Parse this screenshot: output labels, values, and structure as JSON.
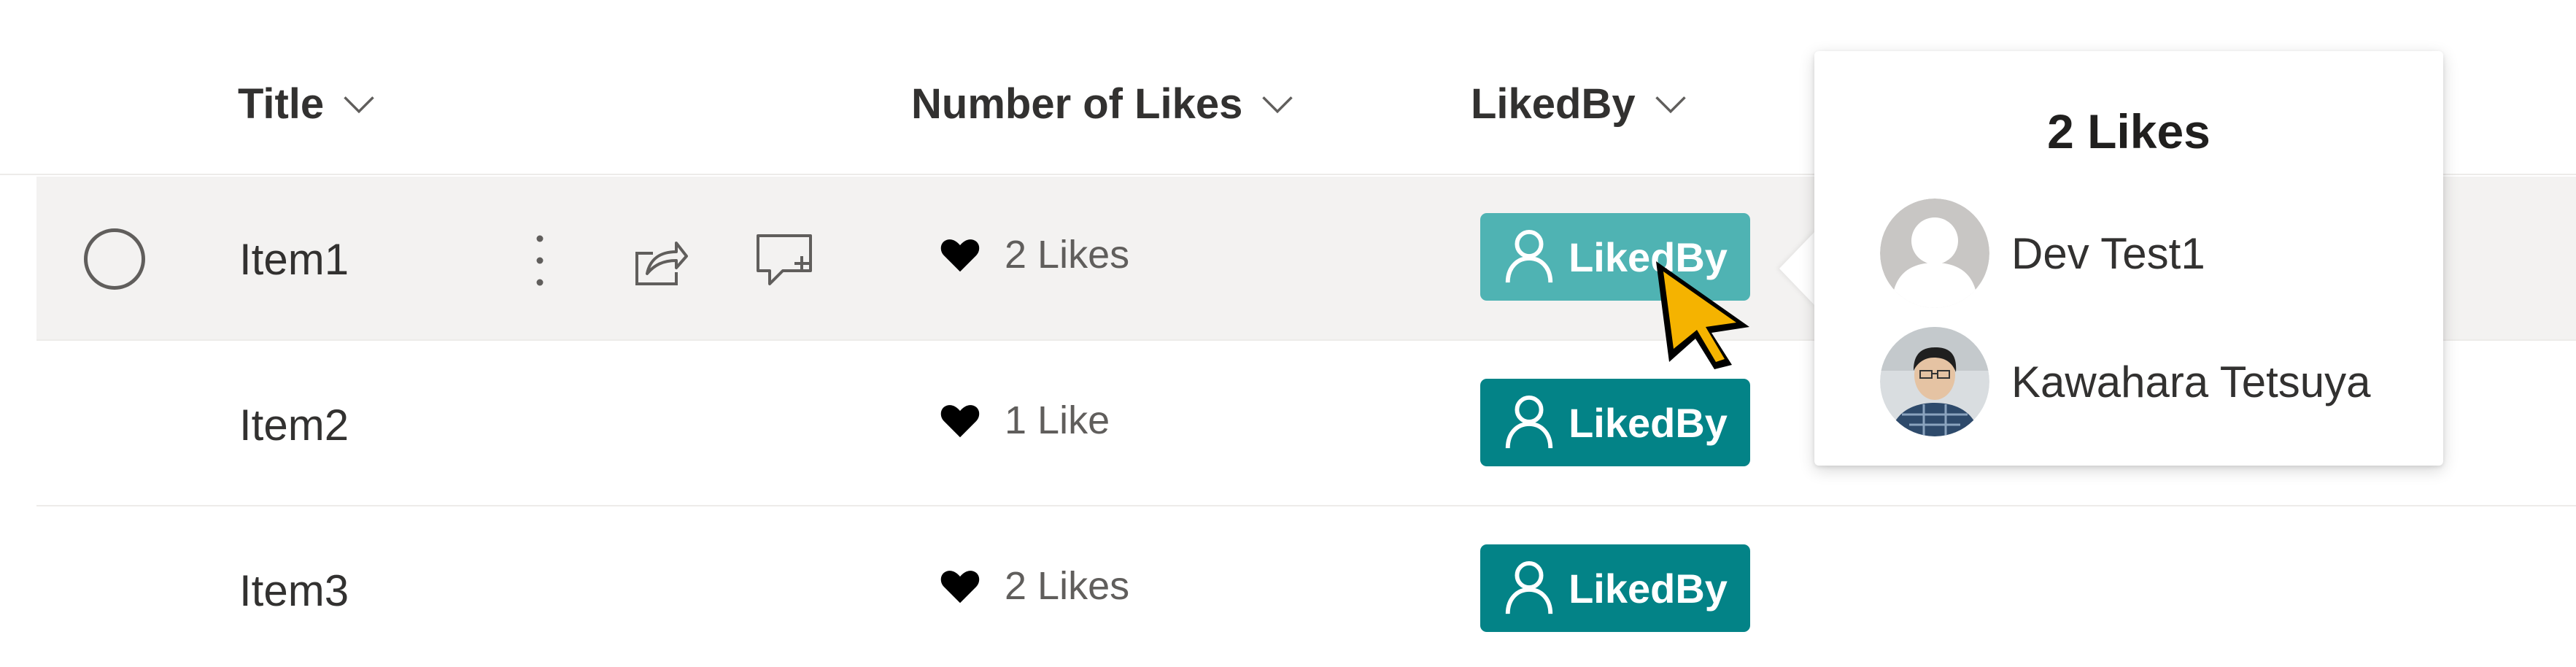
{
  "columns": {
    "title": "Title",
    "likes": "Number of Likes",
    "likedby": "LikedBy"
  },
  "rows": [
    {
      "title": "Item1",
      "likes": "2 Likes",
      "button": "LikedBy",
      "selected": true
    },
    {
      "title": "Item2",
      "likes": "1 Like",
      "button": "LikedBy",
      "selected": false
    },
    {
      "title": "Item3",
      "likes": "2 Likes",
      "button": "LikedBy",
      "selected": false
    }
  ],
  "callout": {
    "title": "2 Likes",
    "people": [
      {
        "name": "Dev Test1",
        "avatar": "default-person-avatar"
      },
      {
        "name": "Kawahara Tetsuya",
        "avatar": "photo-avatar"
      }
    ]
  },
  "icons": {
    "column_sort": "chevron-down-icon",
    "row_select": "radio-circle-icon",
    "more": "more-vertical-icon",
    "share": "share-icon",
    "comment": "comment-add-icon",
    "like": "heart-icon",
    "person": "person-icon",
    "pointer": "mouse-pointer-icon"
  },
  "colors": {
    "button": "#038387",
    "button_hover": "#4fb3b3",
    "selected_row": "#f3f2f1",
    "text": "#323130"
  }
}
